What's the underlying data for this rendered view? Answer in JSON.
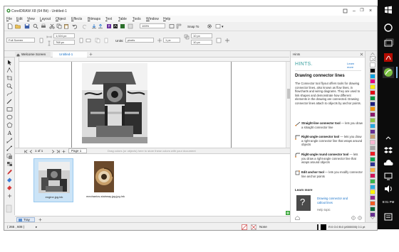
{
  "app": {
    "title": "CorelDRAW X8 (64 Bit) - Untitled-1",
    "menu": [
      "File",
      "Edit",
      "View",
      "Layout",
      "Object",
      "Effects",
      "Bitmaps",
      "Text",
      "Table",
      "Tools",
      "Window",
      "Help"
    ]
  },
  "toolbar": {
    "zoom": "100%",
    "snap_to": "Snap To",
    "launch": "▾"
  },
  "propertybar": {
    "page_preset": "Full Screen",
    "width": "1,024 px",
    "height": "768 px",
    "units_label": "Units:",
    "units": "pixels",
    "nudge": "1 px",
    "dup_x": "10 px",
    "dup_y": "10 px"
  },
  "doc_tabs": [
    {
      "label": "Welcome Screen"
    },
    {
      "label": "Untitled-1"
    }
  ],
  "pagebar": {
    "page_of": "1  of  1",
    "page_tab": "Page 1",
    "hint": "Drag colors (or objects) here to store these colors with your document"
  },
  "tray": {
    "items": [
      {
        "label": "engine.jpg.lnk"
      },
      {
        "label": "mechanics-stairway.jpg.jpg.lnk"
      }
    ],
    "tab_label": "Tray"
  },
  "status": {
    "coords": "( 265 , 608 )",
    "arrow": "▸",
    "fill_none": "None",
    "color_info": "R:0 G:0 B:0 (#000000)  0.1 pt"
  },
  "hints_panel": {
    "header": "Hints",
    "brand": "HINTS.",
    "learn_more_link": "Learn more",
    "title": "Drawing connector lines",
    "intro": "The Connector tool flyout offers tools for drawing connector lines, also known as flow lines, in flowcharts and wiring diagrams. They are used to link shapes and demonstrate how different elements in the drawing are connected. Drawing connector lines attach to objects by anchor points.",
    "tools": [
      {
        "name": "Straight-line connector tool",
        "desc": " — lets you draw a straight connector line"
      },
      {
        "name": "Right-angle connector tool",
        "desc": " — lets you draw a right-angle connector line that wraps around objects"
      },
      {
        "name": "Right-angle round connector tool",
        "desc": " — lets you draw a right-angle connector line that wraps around objects"
      },
      {
        "name": "Edit anchor tool",
        "desc": " — lets you modify connector line anchor points"
      }
    ],
    "learn_more_heading": "Learn more",
    "related_link": "Drawing connector and callout lines",
    "help_topic": "Help topic"
  },
  "palette_colors": [
    "#ffffff",
    "#000000",
    "#00a0e3",
    "#e6007e",
    "#ffed00",
    "#e30613",
    "#009640",
    "#1d1d7e",
    "#f39200",
    "#8b1a6b",
    "#8cc63f",
    "#27aae1",
    "#662d91",
    "#c69c6d",
    "#f7b6d2",
    "#a6a6a6",
    "#ed1c24",
    "#00a651",
    "#2e3192",
    "#fbb040",
    "#d4145a",
    "#39b54a",
    "#29abe2",
    "#fff200",
    "#92278f",
    "#f15a24",
    "#006837",
    "#662d91"
  ],
  "taskbar": {
    "time": "8:01 PM"
  },
  "accent": "#1a73c9"
}
